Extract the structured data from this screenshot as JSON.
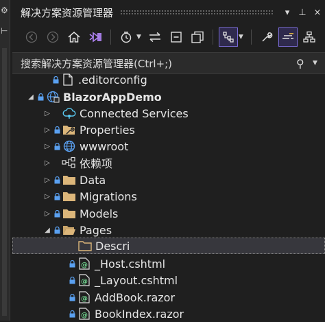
{
  "panel": {
    "title": "解决方案资源管理器",
    "title_buttons": [
      "▾",
      "⊥",
      "×"
    ]
  },
  "toolbar": {
    "buttons": [
      "back-icon",
      "forward-icon",
      "home-icon",
      "vs-switch-views-icon",
      "history-icon",
      "sync-icon",
      "collapse-all-icon",
      "show-all-files-icon",
      "filter-pending-changes-icon",
      "properties-wrench-icon",
      "preview-selected-icon",
      "class-view-icon"
    ]
  },
  "search": {
    "placeholder": "搜索解决方案资源管理器(Ctrl+;)"
  },
  "tree": {
    "items": [
      {
        "label": ".editorconfig",
        "icon": "file-icon"
      },
      {
        "label": "BlazorAppDemo",
        "icon": "web-project-icon"
      },
      {
        "label": "Connected Services",
        "icon": "connected-services-icon"
      },
      {
        "label": "Properties",
        "icon": "properties-folder-icon"
      },
      {
        "label": "wwwroot",
        "icon": "globe-icon"
      },
      {
        "label": "依赖项",
        "icon": "dependencies-icon"
      },
      {
        "label": "Data",
        "icon": "folder-icon"
      },
      {
        "label": "Migrations",
        "icon": "folder-icon"
      },
      {
        "label": "Models",
        "icon": "folder-icon"
      },
      {
        "label": "Pages",
        "icon": "folder-open-icon"
      },
      {
        "label": "Descri",
        "icon": "folder-icon"
      },
      {
        "label": "_Host.cshtml",
        "icon": "razor-file-icon"
      },
      {
        "label": "_Layout.cshtml",
        "icon": "razor-file-icon"
      },
      {
        "label": "AddBook.razor",
        "icon": "razor-file-icon"
      },
      {
        "label": "BookIndex.razor",
        "icon": "razor-file-icon"
      }
    ]
  },
  "colors": {
    "background": "#1f1f1f",
    "accent": "#7b6cd9",
    "folder": "#dcb67a",
    "lock": "#5aa0f0"
  }
}
